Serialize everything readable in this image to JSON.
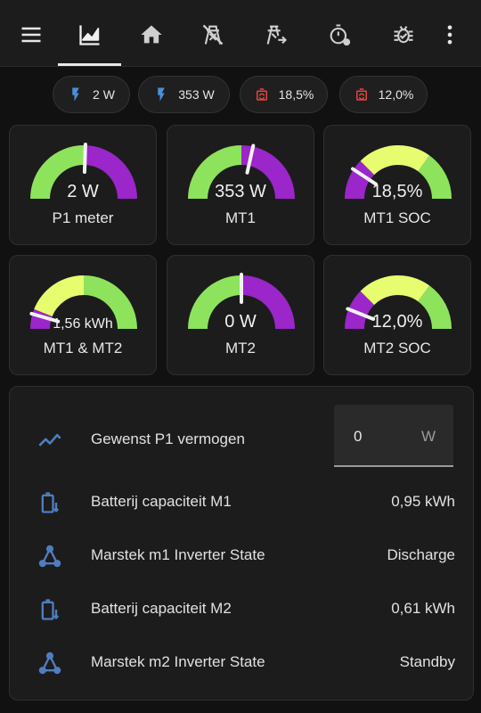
{
  "colors": {
    "accent_blue": "#4a90d9",
    "alert_red": "#e4463e",
    "gauge_green": "#8ee35c",
    "gauge_yellow": "#e7fc6f",
    "gauge_purple": "#9b26c9",
    "entity_icon": "#4f7dc0"
  },
  "topbar": {
    "icons": [
      "menu-icon",
      "chart-icon",
      "home-icon",
      "transmission-tower-off-icon",
      "transmission-tower-export-icon",
      "timer-cog-icon",
      "bug-check-icon",
      "more-vertical-icon"
    ],
    "active_index": 1
  },
  "chips": [
    {
      "icon": "flash-icon",
      "value": "2 W"
    },
    {
      "icon": "flash-icon",
      "value": "353 W"
    },
    {
      "icon": "battery-sync-icon",
      "value": "18,5%"
    },
    {
      "icon": "battery-sync-icon",
      "value": "12,0%"
    }
  ],
  "gauges": [
    {
      "name": "P1 meter",
      "value": "2 W",
      "level": 0.51,
      "segments": "power"
    },
    {
      "name": "MT1",
      "value": "353 W",
      "level": 0.57,
      "segments": "power"
    },
    {
      "name": "MT1 SOC",
      "value": "18,5%",
      "level": 0.185,
      "segments": "soc"
    },
    {
      "name": "MT1 & MT2",
      "value": "1,56 kWh",
      "level": 0.09,
      "segments": "energy"
    },
    {
      "name": "MT2",
      "value": "0 W",
      "level": 0.5,
      "segments": "power"
    },
    {
      "name": "MT2 SOC",
      "value": "12,0%",
      "level": 0.12,
      "segments": "soc"
    }
  ],
  "entities": {
    "p1_target": {
      "icon": "chart-line-icon",
      "label": "Gewenst P1 vermogen",
      "value": "0",
      "unit": "W"
    },
    "rows": [
      {
        "icon": "battery-arrow-down-icon",
        "label": "Batterij capaciteit M1",
        "value": "0,95 kWh"
      },
      {
        "icon": "state-machine-icon",
        "label": "Marstek m1 Inverter State",
        "value": "Discharge"
      },
      {
        "icon": "battery-arrow-down-icon",
        "label": "Batterij capaciteit M2",
        "value": "0,61 kWh"
      },
      {
        "icon": "state-machine-icon",
        "label": "Marstek m2 Inverter State",
        "value": "Standby"
      }
    ]
  }
}
